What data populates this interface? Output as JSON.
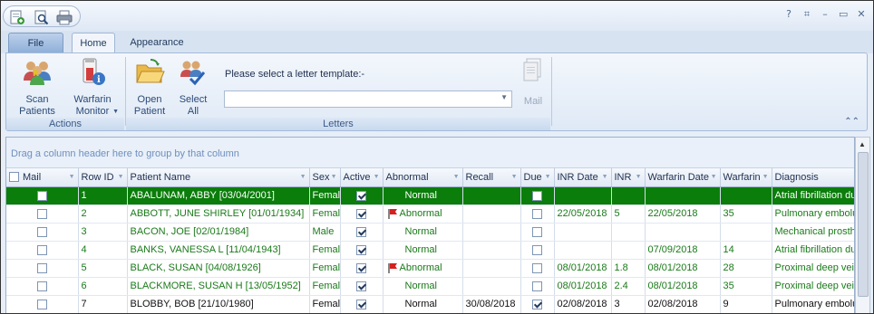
{
  "tabs": [
    {
      "label": "File"
    },
    {
      "label": "Home"
    },
    {
      "label": "Appearance"
    }
  ],
  "ribbon": {
    "actions": {
      "group_label": "Actions",
      "scan_patients": "Scan\nPatients",
      "warfarin_monitor": "Warfarin\nMonitor"
    },
    "letters": {
      "group_label": "Letters",
      "open_patient": "Open\nPatient",
      "select_all": "Select\nAll",
      "template_prompt": "Please select a letter template:-",
      "template_value": "",
      "mail": "Mail"
    }
  },
  "grid": {
    "group_hint": "Drag a column header here to group by that column",
    "columns": [
      "Mail",
      "Row ID",
      "Patient Name",
      "Sex",
      "Active",
      "Abnormal",
      "Recall",
      "Due",
      "INR Date",
      "INR",
      "Warfarin Date",
      "Warfarin",
      "Diagnosis"
    ],
    "rows": [
      {
        "mail": false,
        "row_id": "1",
        "name": "ABALUNAM, ABBY  [03/04/2001]",
        "sex": "Femal",
        "active": true,
        "abnormal": "Normal",
        "flag": false,
        "recall": "",
        "due": false,
        "inr_date": "",
        "inr": "",
        "warfarin_date": "",
        "warfarin": "",
        "diagnosis": "Atrial fibrillation du"
      },
      {
        "mail": false,
        "row_id": "2",
        "name": "ABBOTT, JUNE SHIRLEY  [01/01/1934]",
        "sex": "Femal",
        "active": true,
        "abnormal": "Abnormal",
        "flag": true,
        "recall": "",
        "due": false,
        "inr_date": "22/05/2018",
        "inr": "5",
        "warfarin_date": "22/05/2018",
        "warfarin": "35",
        "diagnosis": "Pulmonary embolu"
      },
      {
        "mail": false,
        "row_id": "3",
        "name": "BACON, JOE  [02/01/1984]",
        "sex": "Male",
        "active": true,
        "abnormal": "Normal",
        "flag": false,
        "recall": "",
        "due": false,
        "inr_date": "",
        "inr": "",
        "warfarin_date": "",
        "warfarin": "",
        "diagnosis": "Mechanical prosth"
      },
      {
        "mail": false,
        "row_id": "4",
        "name": "BANKS, VANESSA L  [11/04/1943]",
        "sex": "Femal",
        "active": true,
        "abnormal": "Normal",
        "flag": false,
        "recall": "",
        "due": false,
        "inr_date": "",
        "inr": "",
        "warfarin_date": "07/09/2018",
        "warfarin": "14",
        "diagnosis": "Atrial fibrillation du"
      },
      {
        "mail": false,
        "row_id": "5",
        "name": "BLACK, SUSAN  [04/08/1926]",
        "sex": "Femal",
        "active": true,
        "abnormal": "Abnormal",
        "flag": true,
        "recall": "",
        "due": false,
        "inr_date": "08/01/2018",
        "inr": "1.8",
        "warfarin_date": "08/01/2018",
        "warfarin": "28",
        "diagnosis": "Proximal deep vei"
      },
      {
        "mail": false,
        "row_id": "6",
        "name": "BLACKMORE, SUSAN H  [13/05/1952]",
        "sex": "Femal",
        "active": true,
        "abnormal": "Normal",
        "flag": false,
        "recall": "",
        "due": false,
        "inr_date": "08/01/2018",
        "inr": "2.4",
        "warfarin_date": "08/01/2018",
        "warfarin": "35",
        "diagnosis": "Proximal deep vei"
      },
      {
        "mail": false,
        "row_id": "7",
        "name": "BLOBBY, BOB  [21/10/1980]",
        "sex": "Femal",
        "active": true,
        "abnormal": "Normal",
        "flag": false,
        "recall": "30/08/2018",
        "due": true,
        "inr_date": "02/08/2018",
        "inr": "3",
        "warfarin_date": "02/08/2018",
        "warfarin": "9",
        "diagnosis": "Pulmonary embolu"
      }
    ]
  }
}
